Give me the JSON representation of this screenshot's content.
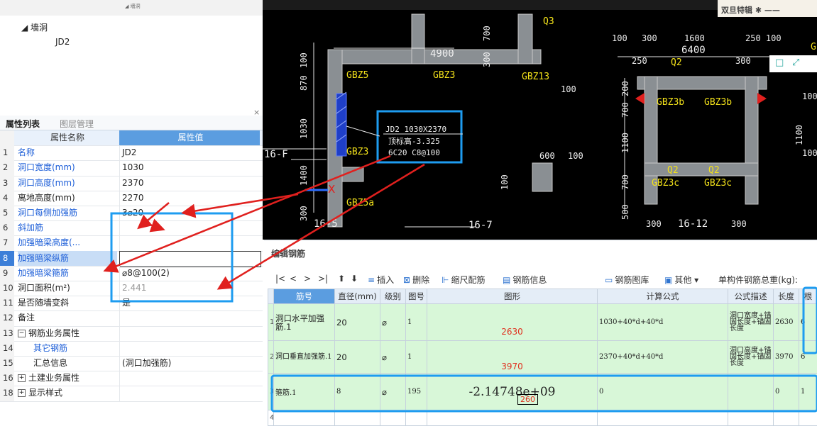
{
  "top_strip": {
    "mini_tree": "◢ 墙洞",
    "mini_child": "JD2"
  },
  "tree": {
    "root_label": "◢  墙洞",
    "child_label": "JD2"
  },
  "panel": {
    "close_glyph": "×",
    "tab_props": "属性列表",
    "tab_layers": "图层管理"
  },
  "prop_grid": {
    "header_name": "属性名称",
    "header_value": "属性值",
    "rows": [
      {
        "n": "1",
        "name": "名称",
        "value": "JD2"
      },
      {
        "n": "2",
        "name": "洞口宽度(mm)",
        "value": "1030"
      },
      {
        "n": "3",
        "name": "洞口高度(mm)",
        "value": "2370"
      },
      {
        "n": "4",
        "name": "离地高度(mm)",
        "value": "2270"
      },
      {
        "n": "5",
        "name": "洞口每侧加强筋",
        "value": "3⌀20"
      },
      {
        "n": "6",
        "name": "斜加筋",
        "value": ""
      },
      {
        "n": "7",
        "name": "加强暗梁高度(...",
        "value": ""
      },
      {
        "n": "8",
        "name": "加强暗梁纵筋",
        "value": ""
      },
      {
        "n": "9",
        "name": "加强暗梁箍筋",
        "value": "⌀8@100(2)"
      },
      {
        "n": "10",
        "name": "洞口面积(m²)",
        "value": "2.441"
      },
      {
        "n": "11",
        "name": "是否随墙变斜",
        "value": "是"
      },
      {
        "n": "12",
        "name": "备注",
        "value": ""
      },
      {
        "n": "13",
        "name": "钢筋业务属性",
        "value": ""
      },
      {
        "n": "14",
        "name": "其它钢筋",
        "value": ""
      },
      {
        "n": "15",
        "name": "汇总信息",
        "value": "(洞口加强筋)"
      },
      {
        "n": "16",
        "name": "土建业务属性",
        "value": ""
      },
      {
        "n": "18",
        "name": "显示样式",
        "value": ""
      }
    ]
  },
  "cad": {
    "watermark": "双旦特辑 ✱ ——",
    "labels": {
      "dim_4900": "4900",
      "dim_6400": "6400",
      "dim_1600": "1600",
      "dim_100a": "100",
      "dim_300a": "300",
      "dim_250a": "250 100",
      "dim_250b": "250",
      "dim_300b": "300",
      "dim_600": "600",
      "dim_100b": "100",
      "dim_870": "870",
      "dim_100c": "100",
      "dim_1030": "1030",
      "dim_1400": "1400",
      "dim_300c": "300",
      "dim_700": "700",
      "dim_300d": "300",
      "dim_200": "200",
      "dim_100d": "100",
      "dim_700b": "700",
      "dim_1100": "1100",
      "dim_700c": "700",
      "dim_500": "500",
      "dim_100e": "100",
      "dim_300e": "300",
      "dim_300f": "300",
      "dim_100g": "100",
      "dim_1100b": "1100",
      "dim_100h": "100",
      "dim_100i": "100",
      "gbz5": "GBZ5",
      "gbz3": "GBZ3",
      "gbz13": "GBZ13",
      "gbz3b": "GBZ3",
      "gbz5a": "GBZ5a",
      "gbz3b_1": "GBZ3b",
      "gbz3b_2": "GBZ3b",
      "gbz3c_1": "GBZ3c",
      "gbz3c_2": "GBZ3c",
      "q2_a": "Q2",
      "q2_b": "Q2",
      "q2_c": "Q2",
      "q3": "Q3",
      "axis_16f": "16-F",
      "axis_16_5": "16-5",
      "axis_16_7": "16-7",
      "axis_16_12": "16-12",
      "jd_line1": "JD2 1030X2370",
      "jd_line2": "顶标高-3.325",
      "jd_line3": "6C20 C8@100",
      "x_mark": "X",
      "g_mark": "G"
    }
  },
  "mini_tools": {
    "restore": "□",
    "expand": "⤢"
  },
  "bottom": {
    "title": "编辑钢筋",
    "toolbar": {
      "first": "|<",
      "prev": "<",
      "next": ">",
      "last": ">|",
      "insert": "插入",
      "delete": "删除",
      "scale": "缩尺配筋",
      "info": "钢筋信息",
      "library": "钢筋图库",
      "other": "其他",
      "weight": "单构件钢筋总重(kg):"
    },
    "table": {
      "headers": [
        "筋号",
        "直径(mm)",
        "级别",
        "图号",
        "图形",
        "计算公式",
        "公式描述",
        "长度",
        "根"
      ],
      "rows": [
        {
          "n": "1",
          "name": "洞口水平加强筋.1",
          "dia": "20",
          "grade": "⌀",
          "fig": "1",
          "shape_val": "2630",
          "formula": "1030+40*d+40*d",
          "desc": "洞口宽度+锚固长度+锚固长度",
          "len": "2630",
          "count": "6"
        },
        {
          "n": "2",
          "name": "洞口垂直加强筋.1",
          "dia": "20",
          "grade": "⌀",
          "fig": "1",
          "shape_val": "3970",
          "formula": "2370+40*d+40*d",
          "desc": "洞口高度+锚固长度+锚固长度",
          "len": "3970",
          "count": "6"
        },
        {
          "n": "3",
          "name": "箍筋.1",
          "dia": "8",
          "grade": "⌀",
          "fig": "195",
          "shape_val": "-2.14748e+09",
          "shape_sub": "260",
          "formula": "0",
          "desc": "",
          "len": "0",
          "count": "1"
        },
        {
          "n": "4",
          "name": "",
          "dia": "",
          "grade": "",
          "fig": "",
          "shape_val": "",
          "formula": "",
          "desc": "",
          "len": "",
          "count": ""
        }
      ]
    }
  },
  "colors": {
    "highlight_blue": "#1e9cf0",
    "arrow_red": "#e0201e",
    "cad_green": "#39d353",
    "cad_yellow": "#f3e21a",
    "table_green": "#d8f7d8"
  }
}
